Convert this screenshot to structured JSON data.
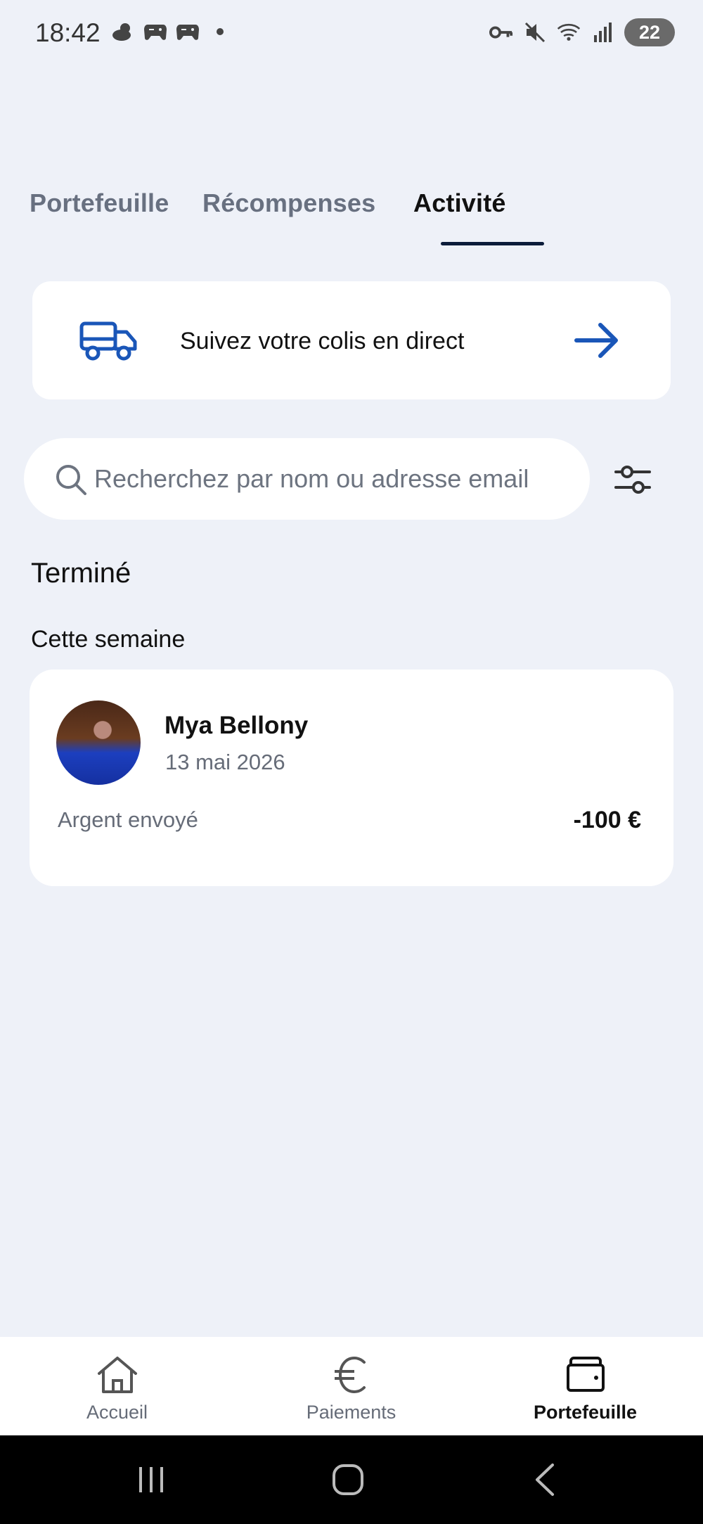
{
  "status_bar": {
    "time": "18:42",
    "left_icons": [
      "weather-icon",
      "game-controller-icon",
      "game-controller-icon",
      "dot-icon"
    ],
    "right_icons": [
      "vpn-key-icon",
      "mute-icon",
      "wifi-icon",
      "signal-icon"
    ],
    "battery": "22"
  },
  "tabs": [
    {
      "label": "Portefeuille",
      "active": false
    },
    {
      "label": "Récompenses",
      "active": false
    },
    {
      "label": "Activité",
      "active": true
    }
  ],
  "tracking_card": {
    "icon": "truck-icon",
    "label": "Suivez votre colis en direct",
    "action_icon": "arrow-right-icon"
  },
  "search": {
    "placeholder": "Recherchez par nom ou adresse email",
    "value": ""
  },
  "section": {
    "title": "Terminé",
    "subtitle": "Cette semaine"
  },
  "activity": [
    {
      "name": "Mya Bellony",
      "date": "13 mai 2026",
      "type": "Argent envoyé",
      "amount": "-100 €"
    }
  ],
  "bottom_nav": [
    {
      "label": "Accueil",
      "icon": "home-icon",
      "active": false
    },
    {
      "label": "Paiements",
      "icon": "euro-icon",
      "active": false
    },
    {
      "label": "Portefeuille",
      "icon": "wallet-icon",
      "active": true
    }
  ],
  "colors": {
    "background": "#eef1f8",
    "accent": "#1a56b8",
    "active_tab_underline": "#0b1c3a"
  }
}
